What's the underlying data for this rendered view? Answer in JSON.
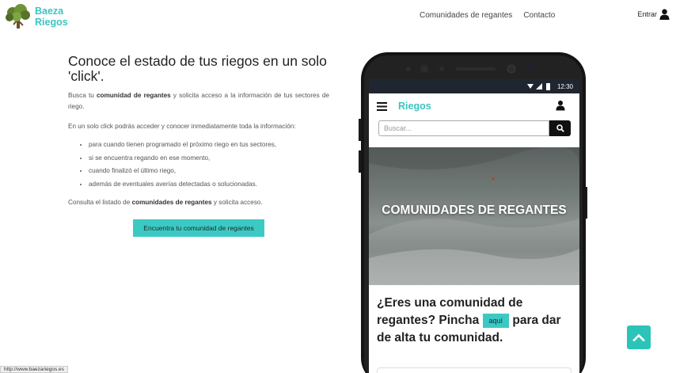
{
  "brand": {
    "line1": "Baeza",
    "line2": "Riegos",
    "color": "#3cc4c0"
  },
  "nav": {
    "communities": "Comunidades de regantes",
    "contact": "Contacto"
  },
  "login": {
    "label": "Entrar",
    "icon": "user-icon"
  },
  "intro": {
    "headline": "Conoce el estado de tus riegos en un solo 'click'.",
    "p1_pre": "Busca tu ",
    "p1_bold": "comunidad de regantes",
    "p1_post": " y solicita acceso a la información de tus sectores de riego.",
    "p2": "En un solo click podrás acceder y conocer inmediatamente toda la información:",
    "bullets": [
      "para cuando tienen programado el próximo riego en tus sectores,",
      "si se encuentra regando en ese momento,",
      "cuando finalizó el último riego,",
      "además de eventuales averías detectadas o solucionadas."
    ],
    "p3_pre": "Consulta el listado de ",
    "p3_bold": "comunidades de regantes",
    "p3_post": " y solicita acceso.",
    "cta": "Encuentra tu comunidad de regantes"
  },
  "phone": {
    "time": "12:30",
    "app_title": "Riegos",
    "search_placeholder": "Buscar...",
    "hero_title": "COMUNIDADES DE REGANTES",
    "question_pre": "¿Eres una comunidad de regantes? Pincha",
    "question_button": "aquí",
    "question_post": "para dar de alta tu comunidad."
  },
  "status_url": "http://www.baezariegos.es",
  "colors": {
    "accent": "#3cc9c4",
    "scroll_top": "#2cc4b8"
  }
}
